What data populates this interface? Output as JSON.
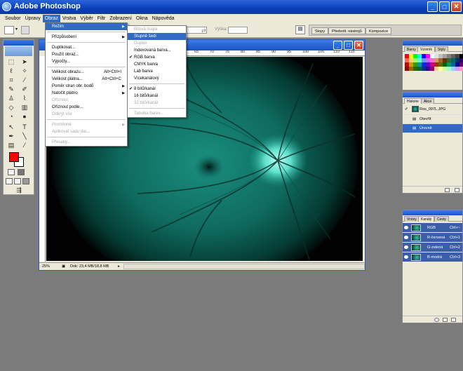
{
  "window": {
    "title": "Adobe Photoshop"
  },
  "menubar": [
    {
      "label": "Soubor"
    },
    {
      "label": "Úpravy"
    },
    {
      "label": "Obraz"
    },
    {
      "label": "Vrstva"
    },
    {
      "label": "Výběr"
    },
    {
      "label": "Filtr"
    },
    {
      "label": "Zobrazení"
    },
    {
      "label": "Okna"
    },
    {
      "label": "Nápověda"
    }
  ],
  "options_bar": {
    "height_label": "Výška:",
    "dock_tabs": [
      "Stopy",
      "Předvolt. nástrojů",
      "Kompozice"
    ]
  },
  "image_menu": {
    "items": [
      {
        "label": "Režim",
        "submenu": true,
        "highlight": true
      },
      {
        "sep": true
      },
      {
        "label": "Přizpůsobení",
        "submenu": true
      },
      {
        "sep": true
      },
      {
        "label": "Duplikovat..."
      },
      {
        "label": "Použít obraz..."
      },
      {
        "label": "Výpočty..."
      },
      {
        "sep": true
      },
      {
        "label": "Velikost obrazu...",
        "shortcut": "Alt+Ctrl+I"
      },
      {
        "label": "Velikost plátna...",
        "shortcut": "Alt+Ctrl+C"
      },
      {
        "label": "Poměr stran obr. bodů",
        "submenu": true
      },
      {
        "label": "Natočit plátno",
        "submenu": true
      },
      {
        "label": "Oříznout",
        "disabled": true
      },
      {
        "label": "Oříznout podle..."
      },
      {
        "label": "Odkrýt vše",
        "disabled": true
      },
      {
        "sep": true
      },
      {
        "label": "Proměnné",
        "submenu": true,
        "disabled": true
      },
      {
        "label": "Aplikovat sadu dat...",
        "disabled": true
      },
      {
        "sep": true
      },
      {
        "label": "Přesahy...",
        "disabled": true
      }
    ]
  },
  "mode_menu": {
    "items": [
      {
        "label": "Bitová mapa",
        "disabled": true
      },
      {
        "label": "Stupně šedi",
        "highlight": true
      },
      {
        "label": "Duplex",
        "disabled": true
      },
      {
        "label": "Indexovaná barva..."
      },
      {
        "label": "RGB barva",
        "checked": true
      },
      {
        "label": "CMYK barva"
      },
      {
        "label": "Lab barva"
      },
      {
        "label": "Vícekanálový"
      },
      {
        "sep": true
      },
      {
        "label": "8 bitů/kanál",
        "checked": true
      },
      {
        "label": "16 bitů/kanál"
      },
      {
        "label": "32 bitů/kanál",
        "disabled": true
      },
      {
        "sep": true
      },
      {
        "label": "Tabulka barev...",
        "disabled": true
      }
    ]
  },
  "document": {
    "ruler_ticks": [
      "60",
      "65",
      "70",
      "75",
      "80",
      "85",
      "90",
      "95",
      "100",
      "105",
      "110",
      "115"
    ],
    "zoom": "25%",
    "doc_info": "Dok: 23,4 MB/18,8 MB"
  },
  "swatches_panel": {
    "tabs": [
      "Barvy",
      "Vzorník",
      "Styly"
    ],
    "colors": [
      "#ff0000",
      "#ffff00",
      "#00ff00",
      "#00ffff",
      "#0000ff",
      "#ff00ff",
      "#ffffff",
      "#e0e0e0",
      "#c0c0c0",
      "#a0a0a0",
      "#808080",
      "#606060",
      "#404040",
      "#000000",
      "#ff6666",
      "#ffcc66",
      "#99ff66",
      "#66ffcc",
      "#6699ff",
      "#cc66ff",
      "#ff66cc",
      "#cc9966",
      "#996633",
      "#663300",
      "#336633",
      "#006666",
      "#003366",
      "#330066",
      "#cc0000",
      "#cc9900",
      "#339900",
      "#009999",
      "#0033cc",
      "#6600cc",
      "#cc0099",
      "#993300",
      "#666600",
      "#006600",
      "#009966",
      "#006699",
      "#000099",
      "#660066",
      "#990000",
      "#996600",
      "#336600",
      "#006633",
      "#003399",
      "#330099",
      "#990066",
      "#ffcc99",
      "#ffff99",
      "#ccff99",
      "#99ffcc",
      "#99ccff",
      "#cc99ff",
      "#ff99cc"
    ]
  },
  "history_panel": {
    "tabs": [
      "Historie",
      "Akce"
    ],
    "snapshot": "Ros_097L.JPG",
    "states": [
      {
        "label": "Otevřít"
      },
      {
        "label": "Úrovně",
        "selected": true
      }
    ]
  },
  "layers_panel": {
    "tabs": [
      "Vrstvy",
      "Kanály",
      "Cesty"
    ],
    "channels": [
      {
        "label": "RGB",
        "shortcut": "Ctrl+~"
      },
      {
        "label": "R-červená",
        "shortcut": "Ctrl+1"
      },
      {
        "label": "G-zelená",
        "shortcut": "Ctrl+2"
      },
      {
        "label": "B-modrá",
        "shortcut": "Ctrl+3"
      }
    ]
  }
}
